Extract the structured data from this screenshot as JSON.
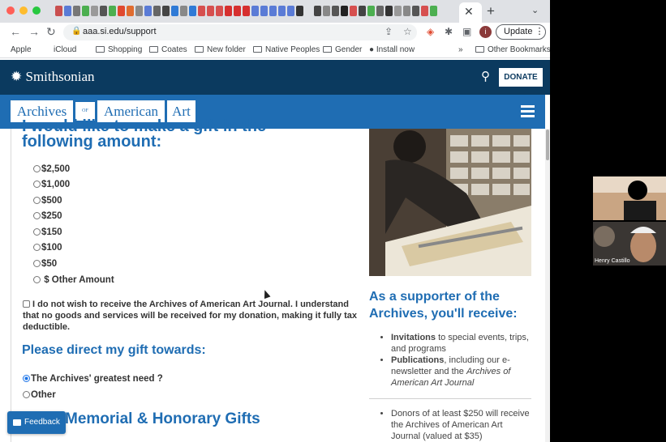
{
  "browser": {
    "url": "aaa.si.edu/support",
    "update_label": "Update",
    "profile_initial": "i"
  },
  "bookmarks": [
    "Apple",
    "iCloud",
    "Shopping",
    "Coates",
    "New folder",
    "Native Peoples",
    "Gender",
    "Install now",
    "Other Bookmarks"
  ],
  "header": {
    "logo_text": "Smithsonian",
    "donate_label": "DONATE"
  },
  "aaa_nav": {
    "word1": "Archives",
    "of": "OF",
    "word2": "American",
    "word3": "Art"
  },
  "form": {
    "heading_partial": "I would like to make a gift in the",
    "heading": "following amount:",
    "amounts": [
      "$2,500",
      "$1,000",
      "$500",
      "$250",
      "$150",
      "$100",
      "$50"
    ],
    "other_amount": "$  Other Amount",
    "no_journal_text": "I do not wish to receive the Archives of American Art Journal. I understand that no goods and services will be received for my donation, making it fully tax deductible.",
    "direct_heading": "Please direct my gift towards:",
    "direct_options": [
      "The Archives' greatest need",
      "Other"
    ],
    "memorial_heading": "Memorial & Honorary Gifts"
  },
  "sidebar": {
    "title": "As a supporter of the Archives, you'll receive:",
    "benefit1_bold": "Invitations",
    "benefit1_rest": " to special events, trips, and programs",
    "benefit2_bold": "Publications",
    "benefit2_rest": ", including our e-newsletter and the ",
    "benefit2_italic": "Archives of American Art Journal",
    "donors_text": "Donors of at least $250 will receive the Archives of American Art Journal (valued at $35)"
  },
  "feedback_label": "Feedback",
  "video": {
    "participant_name": "Henry Castillo"
  },
  "colors": {
    "si_blue": "#0b3a5f",
    "aaa_blue": "#1f6db3"
  }
}
